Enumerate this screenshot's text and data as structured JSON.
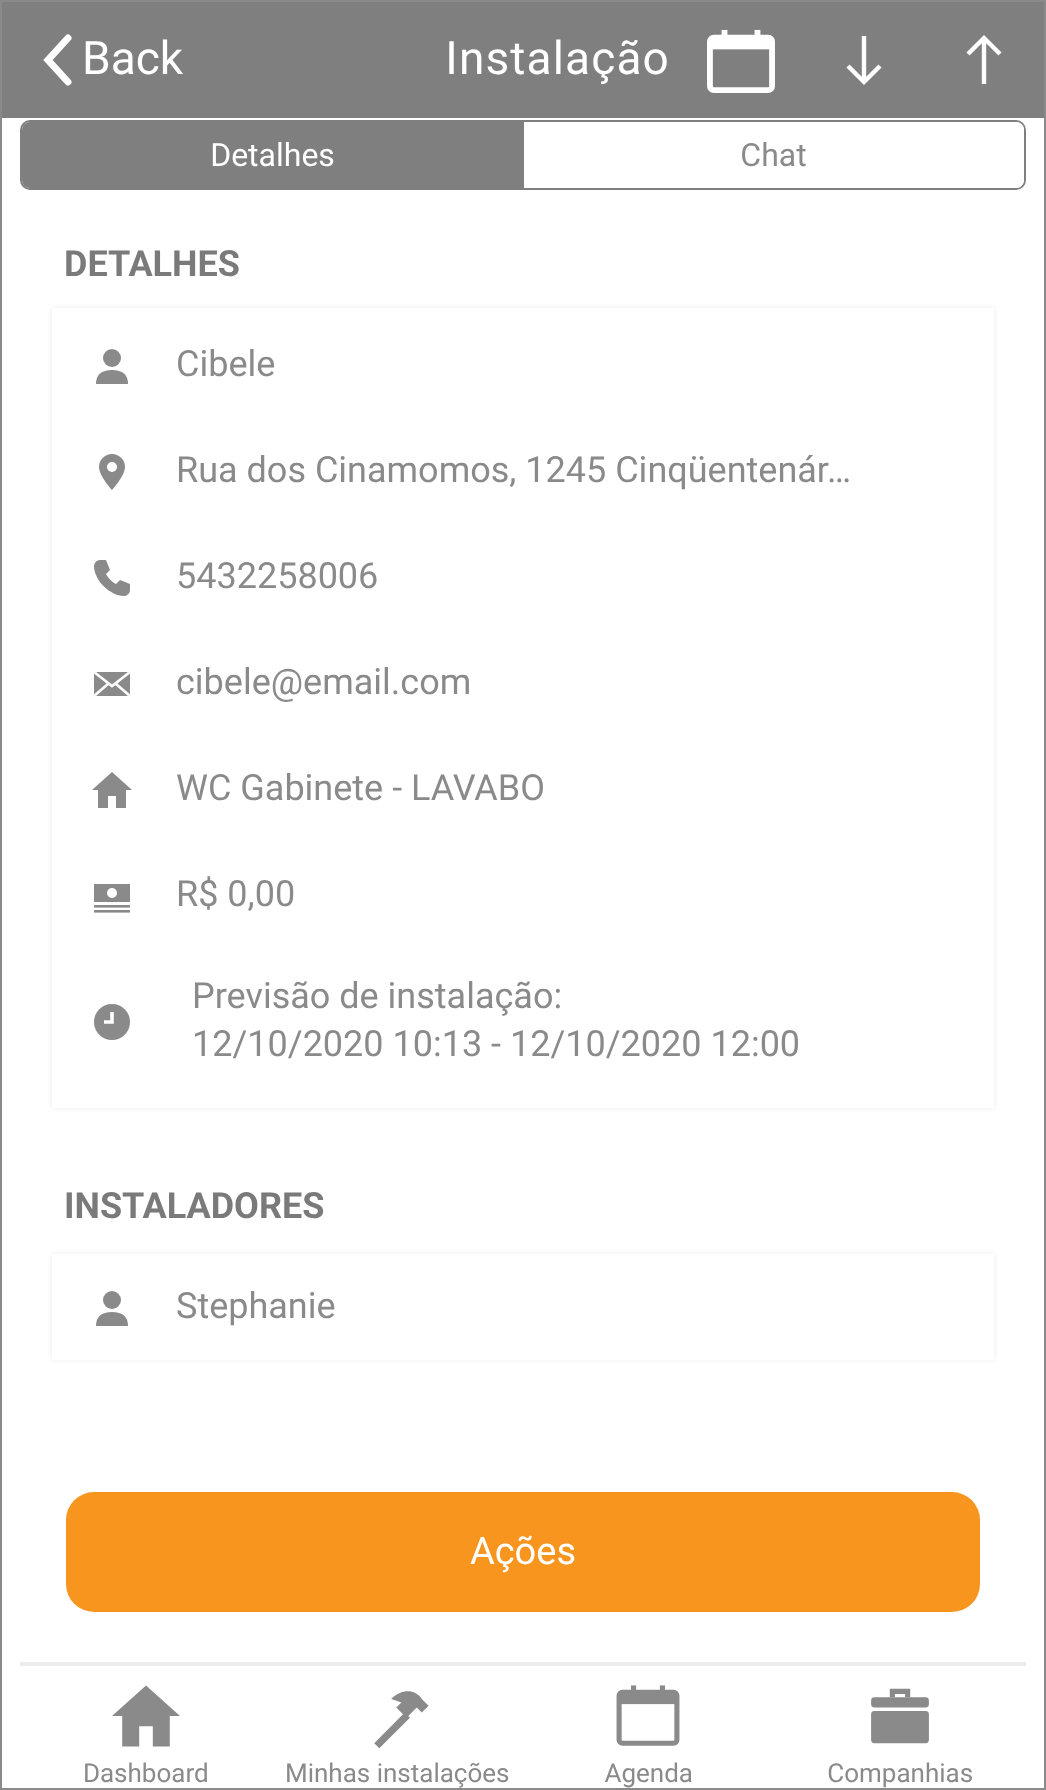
{
  "header": {
    "back": "Back",
    "title": "Instalação"
  },
  "tabs": [
    {
      "label": "Detalhes",
      "selected": true
    },
    {
      "label": "Chat",
      "selected": false
    }
  ],
  "details": {
    "heading": "DETALHES",
    "rows": [
      {
        "kind": "person",
        "text": "Cibele"
      },
      {
        "kind": "pin",
        "text": "Rua dos Cinamomos, 1245 Cinqüentenár…"
      },
      {
        "kind": "phone",
        "text": "5432258006"
      },
      {
        "kind": "mail",
        "text": "cibele@email.com"
      },
      {
        "kind": "home",
        "text": "WC Gabinete - LAVABO"
      },
      {
        "kind": "money",
        "text": "R$ 0,00"
      },
      {
        "kind": "clock",
        "text": "Previsão de instalação:",
        "text_2": "12/10/2020 10:13 - 12/10/2020 12:00"
      }
    ]
  },
  "installers": {
    "heading": "INSTALADORES",
    "rows": [
      {
        "kind": "person",
        "text": "Stephanie"
      }
    ]
  },
  "action_button": "Ações",
  "bottom_nav": [
    {
      "kind": "home",
      "label": "Dashboard"
    },
    {
      "kind": "hammer",
      "label": "Minhas instalações"
    },
    {
      "kind": "calendar",
      "label": "Agenda"
    },
    {
      "kind": "briefcase",
      "label": "Companhias"
    }
  ]
}
